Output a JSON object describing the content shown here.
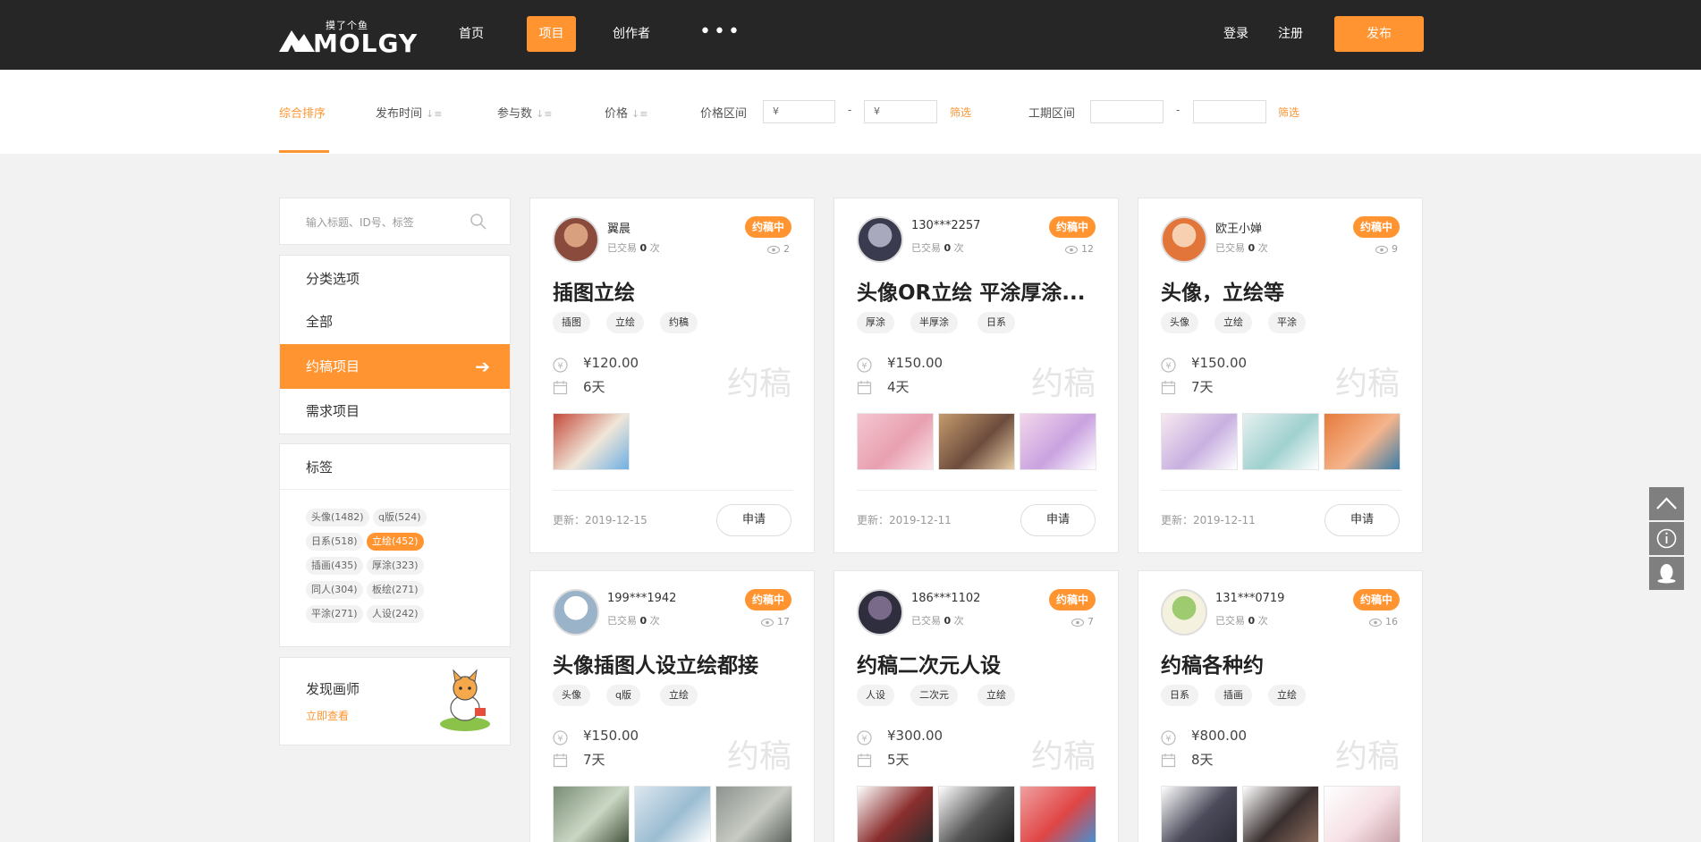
{
  "header": {
    "logo_small": "摸了个鱼",
    "logo_text": "MOLGY",
    "nav": [
      "首页",
      "项目",
      "创作者"
    ],
    "more": "•••",
    "login": "登录",
    "register": "注册",
    "publish": "发布"
  },
  "filters": {
    "sort_composite": "综合排序",
    "sort_time": "发布时间",
    "sort_participants": "参与数",
    "sort_price": "价格",
    "price_range_label": "价格区间",
    "price_min_ph": "¥",
    "price_max_ph": "¥",
    "dash": "-",
    "filter_btn": "筛选",
    "duration_label": "工期区间",
    "sort_icon": "↓≡"
  },
  "sidebar": {
    "search_placeholder": "输入标题、ID号、标签",
    "categories_title": "分类选项",
    "categories": [
      "全部",
      "约稿项目",
      "需求项目"
    ],
    "tags_title": "标签",
    "tags": [
      "头像(1482)",
      "q版(524)",
      "日系(518)",
      "立绘(452)",
      "插画(435)",
      "厚涂(323)",
      "同人(304)",
      "板绘(271)",
      "平涂(271)",
      "人设(242)"
    ],
    "discover_title": "发现画师",
    "discover_link": "立即查看"
  },
  "card_labels": {
    "deals_prefix": "已交易",
    "deals_suffix": "次",
    "status": "约稿中",
    "watermark": "约稿",
    "updated_prefix": "更新：",
    "apply": "申请"
  },
  "cards": [
    {
      "user": "翼晨",
      "deals": "0",
      "views": "2",
      "title": "插图立绘",
      "tags": [
        "插图",
        "立绘",
        "约稿"
      ],
      "price": "¥120.00",
      "days": "6天",
      "updated": "2019-12-15"
    },
    {
      "user": "130***2257",
      "deals": "0",
      "views": "12",
      "title": "头像OR立绘 平涂厚涂...",
      "tags": [
        "厚涂",
        "半厚涂",
        "日系"
      ],
      "price": "¥150.00",
      "days": "4天",
      "updated": "2019-12-11"
    },
    {
      "user": "欧王小婵",
      "deals": "0",
      "views": "9",
      "title": "头像，立绘等",
      "tags": [
        "头像",
        "立绘",
        "平涂"
      ],
      "price": "¥150.00",
      "days": "7天",
      "updated": "2019-12-11"
    },
    {
      "user": "199***1942",
      "deals": "0",
      "views": "17",
      "title": "头像插图人设立绘都接",
      "tags": [
        "头像",
        "q版",
        "立绘"
      ],
      "price": "¥150.00",
      "days": "7天",
      "updated": ""
    },
    {
      "user": "186***1102",
      "deals": "0",
      "views": "7",
      "title": "约稿二次元人设",
      "tags": [
        "人设",
        "二次元",
        "立绘"
      ],
      "price": "¥300.00",
      "days": "5天",
      "updated": ""
    },
    {
      "user": "131***0719",
      "deals": "0",
      "views": "16",
      "title": "约稿各种约",
      "tags": [
        "日系",
        "插画",
        "立绘"
      ],
      "price": "¥800.00",
      "days": "8天",
      "updated": ""
    }
  ],
  "colors": {
    "accent": "#ff9431",
    "header_bg": "#262626",
    "page_bg": "#f2f2f2"
  }
}
